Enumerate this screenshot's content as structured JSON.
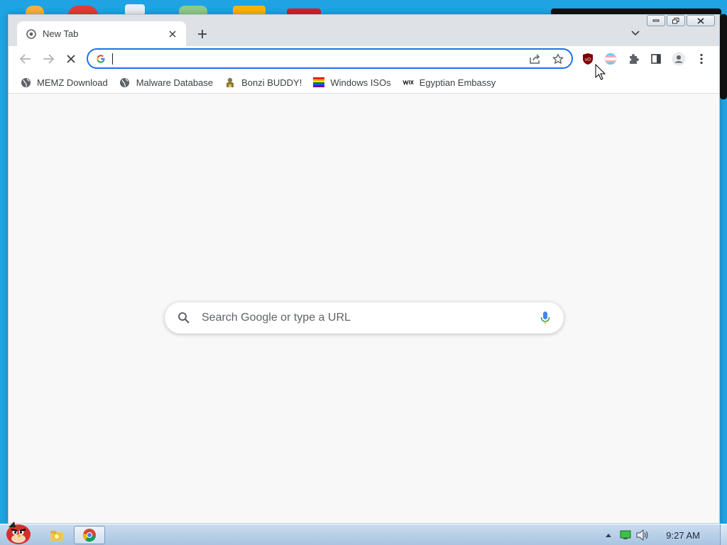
{
  "tab": {
    "title": "New Tab",
    "favicon": "chrome-newtab-icon",
    "close_icon": "close-icon"
  },
  "window_controls": {
    "minimize": "minimize-icon",
    "maximize": "maximize-icon",
    "close": "close-icon"
  },
  "toolbar": {
    "back": "back-arrow-icon",
    "forward": "forward-arrow-icon",
    "stop": "stop-loading-icon",
    "omnibox_value": "",
    "omnibox_actions": [
      "share-icon",
      "bookmark-star-icon"
    ],
    "extensions": [
      "ublock-origin-icon",
      "trans-flag-extension-icon",
      "puzzle-extensions-icon",
      "side-panel-icon",
      "profile-avatar-icon",
      "kebab-menu-icon"
    ]
  },
  "bookmarks": [
    {
      "label": "MEMZ Download",
      "icon": "globe-icon"
    },
    {
      "label": "Malware Database",
      "icon": "globe-icon"
    },
    {
      "label": "Bonzi BUDDY!",
      "icon": "bonzi-icon"
    },
    {
      "label": "Windows ISOs",
      "icon": "rainbow-flag-icon"
    },
    {
      "label": "Egyptian Embassy",
      "icon": "wix-icon"
    }
  ],
  "ntp": {
    "search_placeholder": "Search Google or type a URL"
  },
  "taskbar": {
    "clock": "9:27 AM",
    "tray_icons": [
      "show-hidden-icons-chevron",
      "network-icon",
      "volume-icon"
    ],
    "pinned": [
      "explorer-icon",
      "chrome-icon"
    ]
  },
  "colors": {
    "accent": "#1a73e8",
    "desktop": "#1fa3e3",
    "ublock_red": "#800000"
  }
}
